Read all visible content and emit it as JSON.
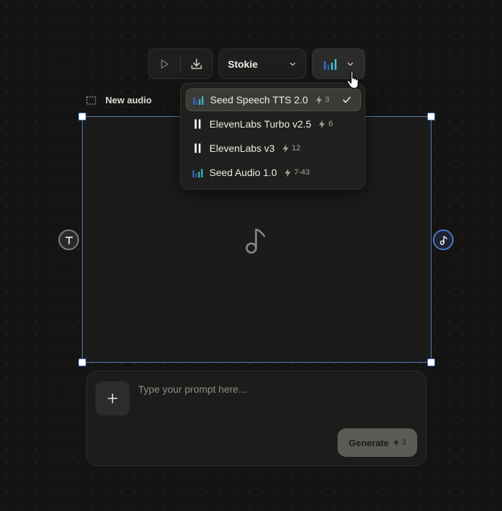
{
  "toolbar": {
    "voice_name": "Stokie"
  },
  "node": {
    "title": "New audio"
  },
  "model_menu": {
    "items": [
      {
        "label": "Seed Speech TTS 2.0",
        "cost": "3",
        "icon": "seed-bars-icon",
        "selected": true
      },
      {
        "label": "ElevenLabs Turbo v2.5",
        "cost": "6",
        "icon": "elevenlabs-icon",
        "selected": false
      },
      {
        "label": "ElevenLabs v3",
        "cost": "12",
        "icon": "elevenlabs-icon",
        "selected": false
      },
      {
        "label": "Seed Audio 1.0",
        "cost": "7-43",
        "icon": "seed-bars-icon",
        "selected": false
      }
    ]
  },
  "prompt": {
    "placeholder": "Type your prompt here...",
    "value": ""
  },
  "generate": {
    "label": "Generate",
    "cost": "3"
  },
  "colors": {
    "accent": "#4a78c9",
    "selection_border": "#5a7dbb",
    "seed_bar_dark": "#3b6fd1",
    "seed_bar_light": "#3fc7d6"
  }
}
